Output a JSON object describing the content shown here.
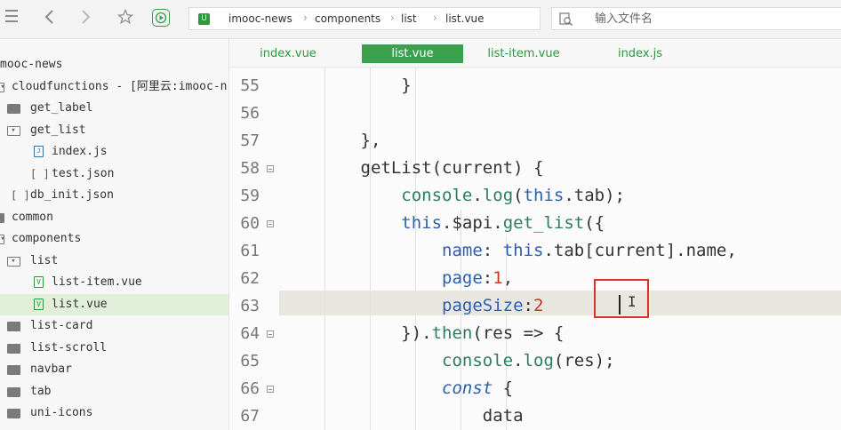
{
  "toolbar": {
    "icons": [
      "menu-icon",
      "back-arrow-icon",
      "forward-arrow-icon",
      "star-icon",
      "run-icon"
    ]
  },
  "breadcrumb": {
    "items": [
      "imooc-news",
      "components",
      "list",
      "list.vue"
    ]
  },
  "search": {
    "placeholder": "输入文件名"
  },
  "sidebar": {
    "items": [
      {
        "label": "mooc-news",
        "depth": 0,
        "type": "root"
      },
      {
        "label": "cloudfunctions - [阿里云:imooc-n",
        "depth": 0,
        "type": "folder-open"
      },
      {
        "label": "get_label",
        "depth": 1,
        "type": "folder"
      },
      {
        "label": "get_list",
        "depth": 1,
        "type": "folder-open"
      },
      {
        "label": "index.js",
        "depth": 2,
        "type": "js"
      },
      {
        "label": "test.json",
        "depth": 2,
        "type": "json"
      },
      {
        "label": "db_init.json",
        "depth": 1,
        "type": "json"
      },
      {
        "label": "common",
        "depth": 0,
        "type": "folder"
      },
      {
        "label": "components",
        "depth": 0,
        "type": "folder-open"
      },
      {
        "label": "list",
        "depth": 1,
        "type": "folder-open"
      },
      {
        "label": "list-item.vue",
        "depth": 2,
        "type": "vue"
      },
      {
        "label": "list.vue",
        "depth": 2,
        "type": "vue",
        "selected": true
      },
      {
        "label": "list-card",
        "depth": 1,
        "type": "folder"
      },
      {
        "label": "list-scroll",
        "depth": 1,
        "type": "folder"
      },
      {
        "label": "navbar",
        "depth": 1,
        "type": "folder"
      },
      {
        "label": "tab",
        "depth": 1,
        "type": "folder"
      },
      {
        "label": "uni-icons",
        "depth": 1,
        "type": "folder"
      }
    ]
  },
  "tabs": [
    {
      "label": "index.vue",
      "active": false
    },
    {
      "label": "list.vue",
      "active": true
    },
    {
      "label": "list-item.vue",
      "active": false
    },
    {
      "label": "index.js",
      "active": false
    }
  ],
  "editor": {
    "lines": [
      {
        "num": "55",
        "fold": false,
        "text": "            }"
      },
      {
        "num": "56",
        "fold": false,
        "text": ""
      },
      {
        "num": "57",
        "fold": false,
        "text": "        },"
      },
      {
        "num": "58",
        "fold": true,
        "text": "        getList(current) {"
      },
      {
        "num": "59",
        "fold": false,
        "text": "            console.log(this.tab);"
      },
      {
        "num": "60",
        "fold": true,
        "text": "            this.$api.get_list({"
      },
      {
        "num": "61",
        "fold": false,
        "text": "                name: this.tab[current].name,"
      },
      {
        "num": "62",
        "fold": false,
        "text": "                page:1,"
      },
      {
        "num": "63",
        "fold": false,
        "text": "                pageSize:2"
      },
      {
        "num": "64",
        "fold": true,
        "text": "            }).then(res => {"
      },
      {
        "num": "65",
        "fold": false,
        "text": "                console.log(res);"
      },
      {
        "num": "66",
        "fold": true,
        "text": "                const {"
      },
      {
        "num": "67",
        "fold": false,
        "text": "                    data"
      }
    ]
  },
  "colors": {
    "accent": "#3ca14d",
    "keyword": "#2d5fb1",
    "method": "#2e7d5b",
    "number": "#c0392b",
    "highlight_box": "#e0302a"
  }
}
